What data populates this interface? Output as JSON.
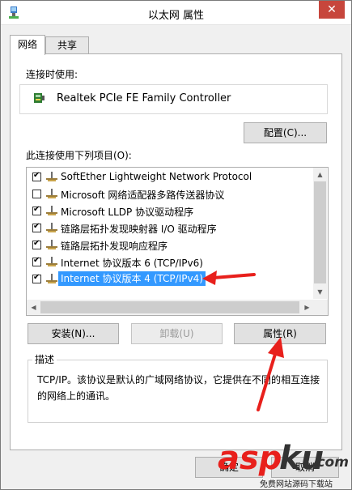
{
  "window": {
    "title": "以太网 属性",
    "close_label": "✕"
  },
  "tabs": [
    {
      "label": "网络",
      "active": true
    },
    {
      "label": "共享",
      "active": false
    }
  ],
  "connect_using": {
    "label": "连接时使用:",
    "adapter_name": "Realtek PCIe FE Family Controller",
    "configure_button": "配置(C)..."
  },
  "items_section": {
    "label": "此连接使用下列项目(O):",
    "items": [
      {
        "label": "SoftEther Lightweight Network Protocol",
        "checked": true
      },
      {
        "label": "Microsoft 网络适配器多路传送器协议",
        "checked": false
      },
      {
        "label": "Microsoft LLDP 协议驱动程序",
        "checked": true
      },
      {
        "label": "链路层拓扑发现映射器 I/O 驱动程序",
        "checked": true
      },
      {
        "label": "链路层拓扑发现响应程序",
        "checked": true
      },
      {
        "label": "Internet 协议版本 6 (TCP/IPv6)",
        "checked": true
      },
      {
        "label": "Internet 协议版本 4 (TCP/IPv4)",
        "checked": true,
        "selected": true
      }
    ]
  },
  "buttons": {
    "install": "安装(N)...",
    "uninstall": "卸载(U)",
    "properties": "属性(R)"
  },
  "description": {
    "legend": "描述",
    "text": "TCP/IP。该协议是默认的广域网络协议，它提供在不同的相互连接的网络上的通讯。"
  },
  "footer": {
    "ok_button": "确定",
    "cancel_button": "取消"
  },
  "watermark": {
    "brand_a": "asp",
    "brand_b": "ku",
    "brand_c": ".com",
    "tagline": "免费网站源码下载站"
  },
  "colors": {
    "selection": "#3399ff",
    "close": "#c7463c",
    "arrow": "#e8201c"
  }
}
